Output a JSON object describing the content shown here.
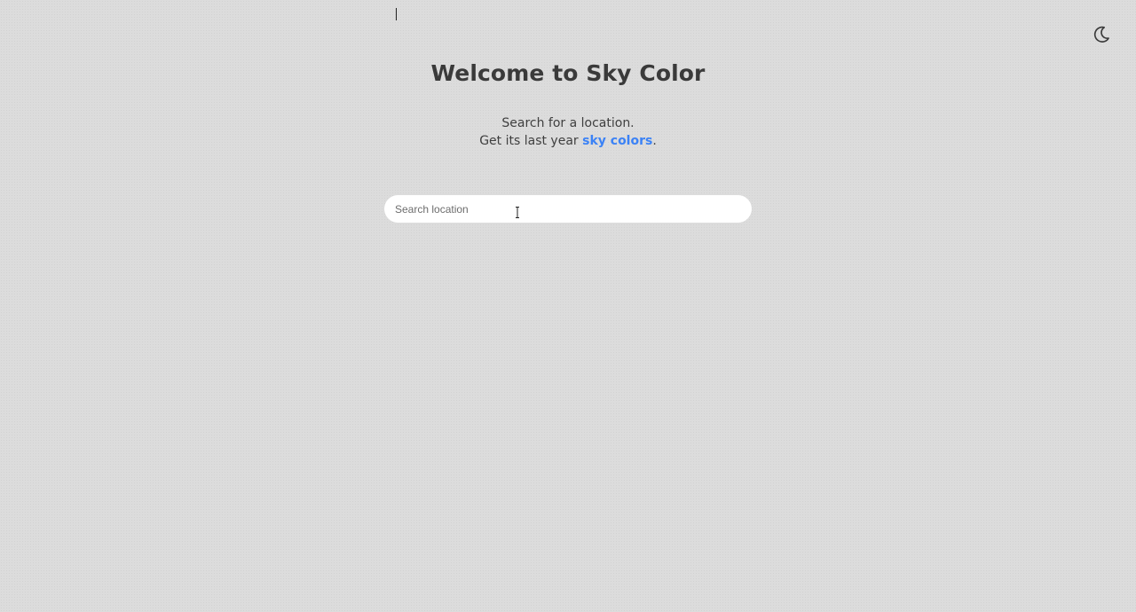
{
  "header": {
    "theme_toggle_icon": "moon-icon"
  },
  "hero": {
    "title": "Welcome to Sky Color",
    "subtitle_line1": "Search for a location.",
    "subtitle_line2_prefix": "Get its last year ",
    "subtitle_link": "sky colors",
    "subtitle_line2_suffix": "."
  },
  "search": {
    "placeholder": "Search location",
    "value": ""
  },
  "colors": {
    "background": "#dcdcdc",
    "text": "#3a3a3a",
    "link": "#3b82f6",
    "input_background": "#ffffff"
  }
}
